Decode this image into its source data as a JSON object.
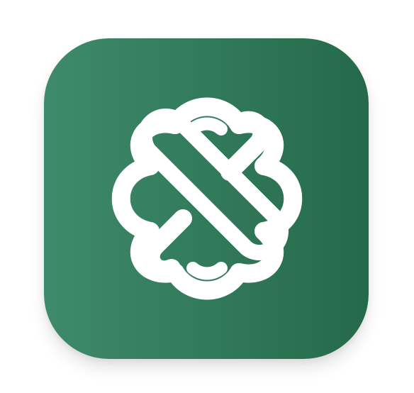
{
  "app_icon": {
    "icon": "knot-logo-icon",
    "colors": {
      "background_left": "#3f8a6c",
      "background_right": "#246a4a",
      "mark": "#ffffff"
    }
  }
}
